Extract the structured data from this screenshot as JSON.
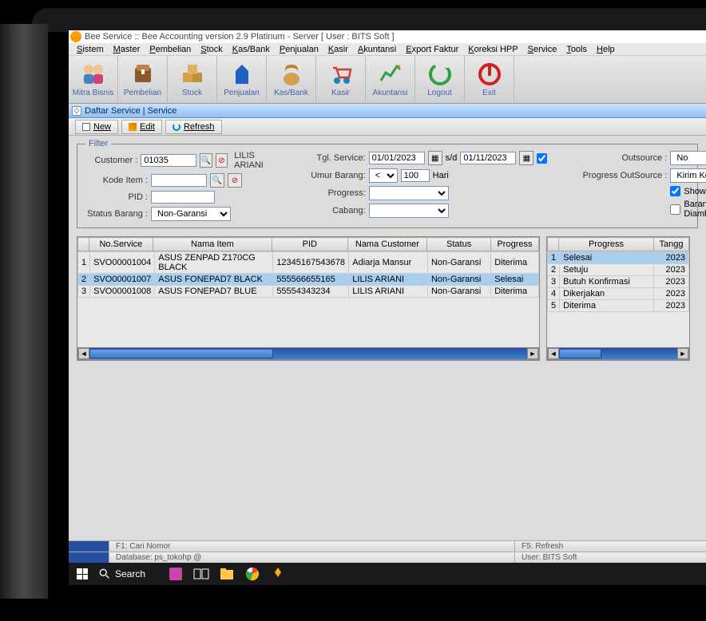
{
  "title": "Bee Service :: Bee Accounting version 2.9 Platinum - Server  [ User : BITS Soft ]",
  "menu": [
    "Sistem",
    "Master",
    "Pembelian",
    "Stock",
    "Kas/Bank",
    "Penjualan",
    "Kasir",
    "Akuntansi",
    "Export Faktur",
    "Koreksi HPP",
    "Service",
    "Tools",
    "Help"
  ],
  "toolbar": [
    {
      "label": "Mitra Bisnis"
    },
    {
      "label": "Pembelian"
    },
    {
      "label": "Stock"
    },
    {
      "label": "Penjualan"
    },
    {
      "label": "Kas/Bank"
    },
    {
      "label": "Kasir"
    },
    {
      "label": "Akuntansi"
    },
    {
      "label": "Logout"
    },
    {
      "label": "Exit"
    }
  ],
  "tab": "Daftar Service | Service",
  "actions": {
    "new": "New",
    "edit": "Edit",
    "refresh": "Refresh"
  },
  "filter": {
    "legend": "Filter",
    "customer_label": "Customer :",
    "customer_code": "01035",
    "customer_name": "LILIS ARIANI",
    "kode_item_label": "Kode Item :",
    "kode_item": "",
    "pid_label": "PID :",
    "pid": "",
    "status_label": "Status Barang :",
    "status": "Non-Garansi",
    "tgl_label": "Tgl. Service:",
    "tgl_from": "01/01/2023",
    "tgl_sep": "s/d",
    "tgl_to": "01/11/2023",
    "umur_label": "Umur Barang:",
    "umur_op": "<",
    "umur_val": "100",
    "umur_unit": "Hari",
    "progress_label": "Progress:",
    "progress": "",
    "cabang_label": "Cabang:",
    "cabang": "",
    "outsource_label": "Outsource :",
    "outsource": "No",
    "prog_out_label": "Progress OutSource :",
    "prog_out": "Kirim Konfirmasi",
    "show_progress": "Show Progress",
    "barang_diambil": "Barang Sudah Diambil"
  },
  "table1": {
    "headers": [
      "No.Service",
      "Nama Item",
      "PID",
      "Nama Customer",
      "Status",
      "Progress"
    ],
    "rows": [
      {
        "no": "1",
        "cells": [
          "SVO00001004",
          "ASUS ZENPAD Z170CG BLACK",
          "12345167543678",
          "Adiarja Mansur",
          "Non-Garansi",
          "Diterima"
        ]
      },
      {
        "no": "2",
        "cells": [
          "SVO00001007",
          "ASUS FONEPAD7 BLACK",
          "555566655165",
          "LILIS ARIANI",
          "Non-Garansi",
          "Selesai"
        ],
        "selected": true
      },
      {
        "no": "3",
        "cells": [
          "SVO00001008",
          "ASUS FONEPAD7 BLUE",
          "55554343234",
          "LILIS ARIANI",
          "Non-Garansi",
          "Diterima"
        ]
      }
    ]
  },
  "table2": {
    "headers": [
      "Progress",
      "Tangg"
    ],
    "rows": [
      {
        "no": "1",
        "cells": [
          "Selesai",
          "2023"
        ],
        "selected": true
      },
      {
        "no": "2",
        "cells": [
          "Setuju",
          "2023"
        ]
      },
      {
        "no": "3",
        "cells": [
          "Butuh Konfirmasi",
          "2023"
        ]
      },
      {
        "no": "4",
        "cells": [
          "Dikerjakan",
          "2023"
        ]
      },
      {
        "no": "5",
        "cells": [
          "Diterima",
          "2023"
        ]
      }
    ]
  },
  "status": {
    "f1": "F1: Cari Nomor",
    "f5": "F5: Refresh",
    "db": "Database: ps_tokohp @",
    "user": "User: BITS Soft"
  },
  "taskbar": {
    "search": "Search"
  }
}
